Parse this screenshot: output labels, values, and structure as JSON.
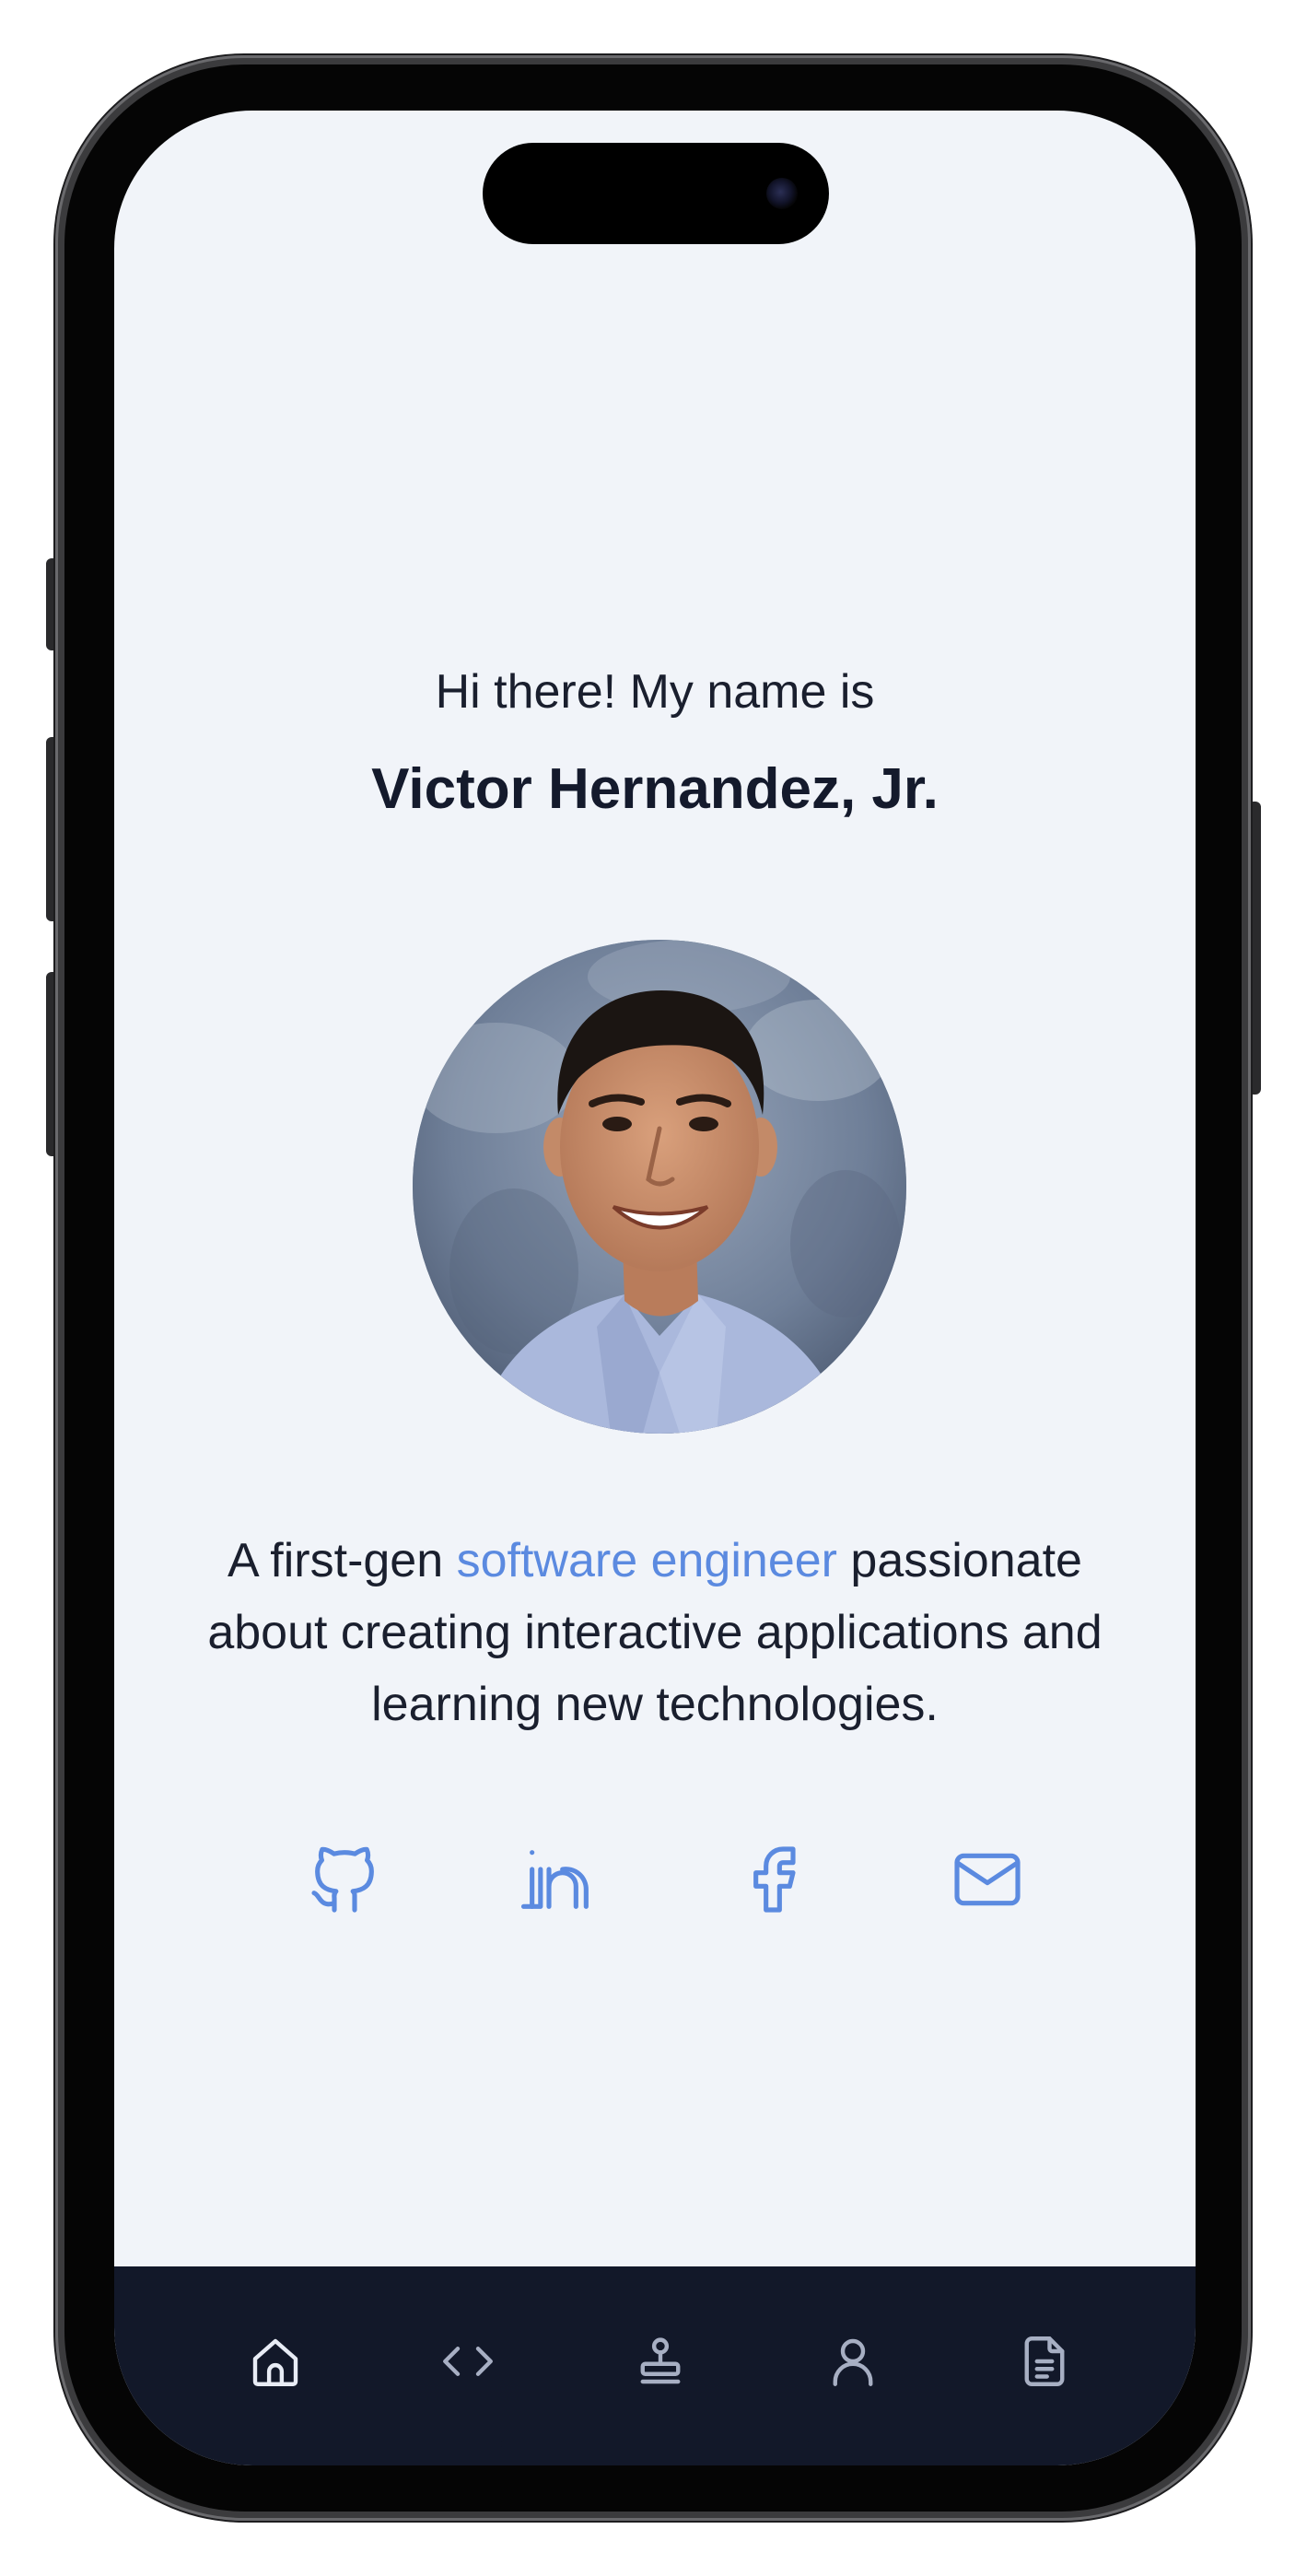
{
  "hero": {
    "greeting": "Hi there! My name is",
    "name": "Victor Hernandez, Jr."
  },
  "bio": {
    "before": "A first-gen ",
    "highlight": "software engineer",
    "after": " passionate about creating interactive applications and learning new technologies."
  },
  "socials": [
    {
      "name": "github",
      "icon": "github-icon"
    },
    {
      "name": "linkedin",
      "icon": "linkedin-icon"
    },
    {
      "name": "facebook",
      "icon": "facebook-icon"
    },
    {
      "name": "email",
      "icon": "mail-icon"
    }
  ],
  "nav": [
    {
      "id": "home",
      "icon": "home-icon",
      "active": true
    },
    {
      "id": "projects",
      "icon": "code-icon",
      "active": false
    },
    {
      "id": "experience",
      "icon": "stamp-icon",
      "active": false
    },
    {
      "id": "about",
      "icon": "user-icon",
      "active": false
    },
    {
      "id": "resume",
      "icon": "document-icon",
      "active": false
    }
  ],
  "colors": {
    "background": "#f1f4f9",
    "accent": "#5b8ae0",
    "text": "#1a1f2e",
    "navbar": "#121829",
    "nav_icon_active": "#e8ecf5",
    "nav_icon_inactive": "#a7afc3"
  }
}
